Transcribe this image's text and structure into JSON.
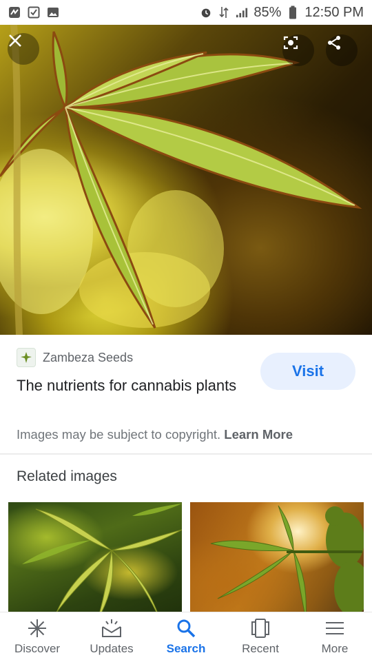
{
  "status_bar": {
    "battery": "85%",
    "time": "12:50 PM"
  },
  "image_viewer": {
    "close_icon": "close-icon",
    "lens_icon": "lens-icon",
    "share_icon": "share-icon"
  },
  "result": {
    "source_name": "Zambeza Seeds",
    "visit_label": "Visit",
    "title": "The nutrients for cannabis plants",
    "copyright_text": "Images may be subject to copyright.",
    "learn_more": "Learn More"
  },
  "related": {
    "title": "Related images"
  },
  "bottom_nav": {
    "items": [
      {
        "label": "Discover",
        "icon": "asterisk-icon"
      },
      {
        "label": "Updates",
        "icon": "updates-icon"
      },
      {
        "label": "Search",
        "icon": "search-icon"
      },
      {
        "label": "Recent",
        "icon": "recent-icon"
      },
      {
        "label": "More",
        "icon": "menu-icon"
      }
    ],
    "active": "Search",
    "accent_color": "#1a73e8"
  }
}
